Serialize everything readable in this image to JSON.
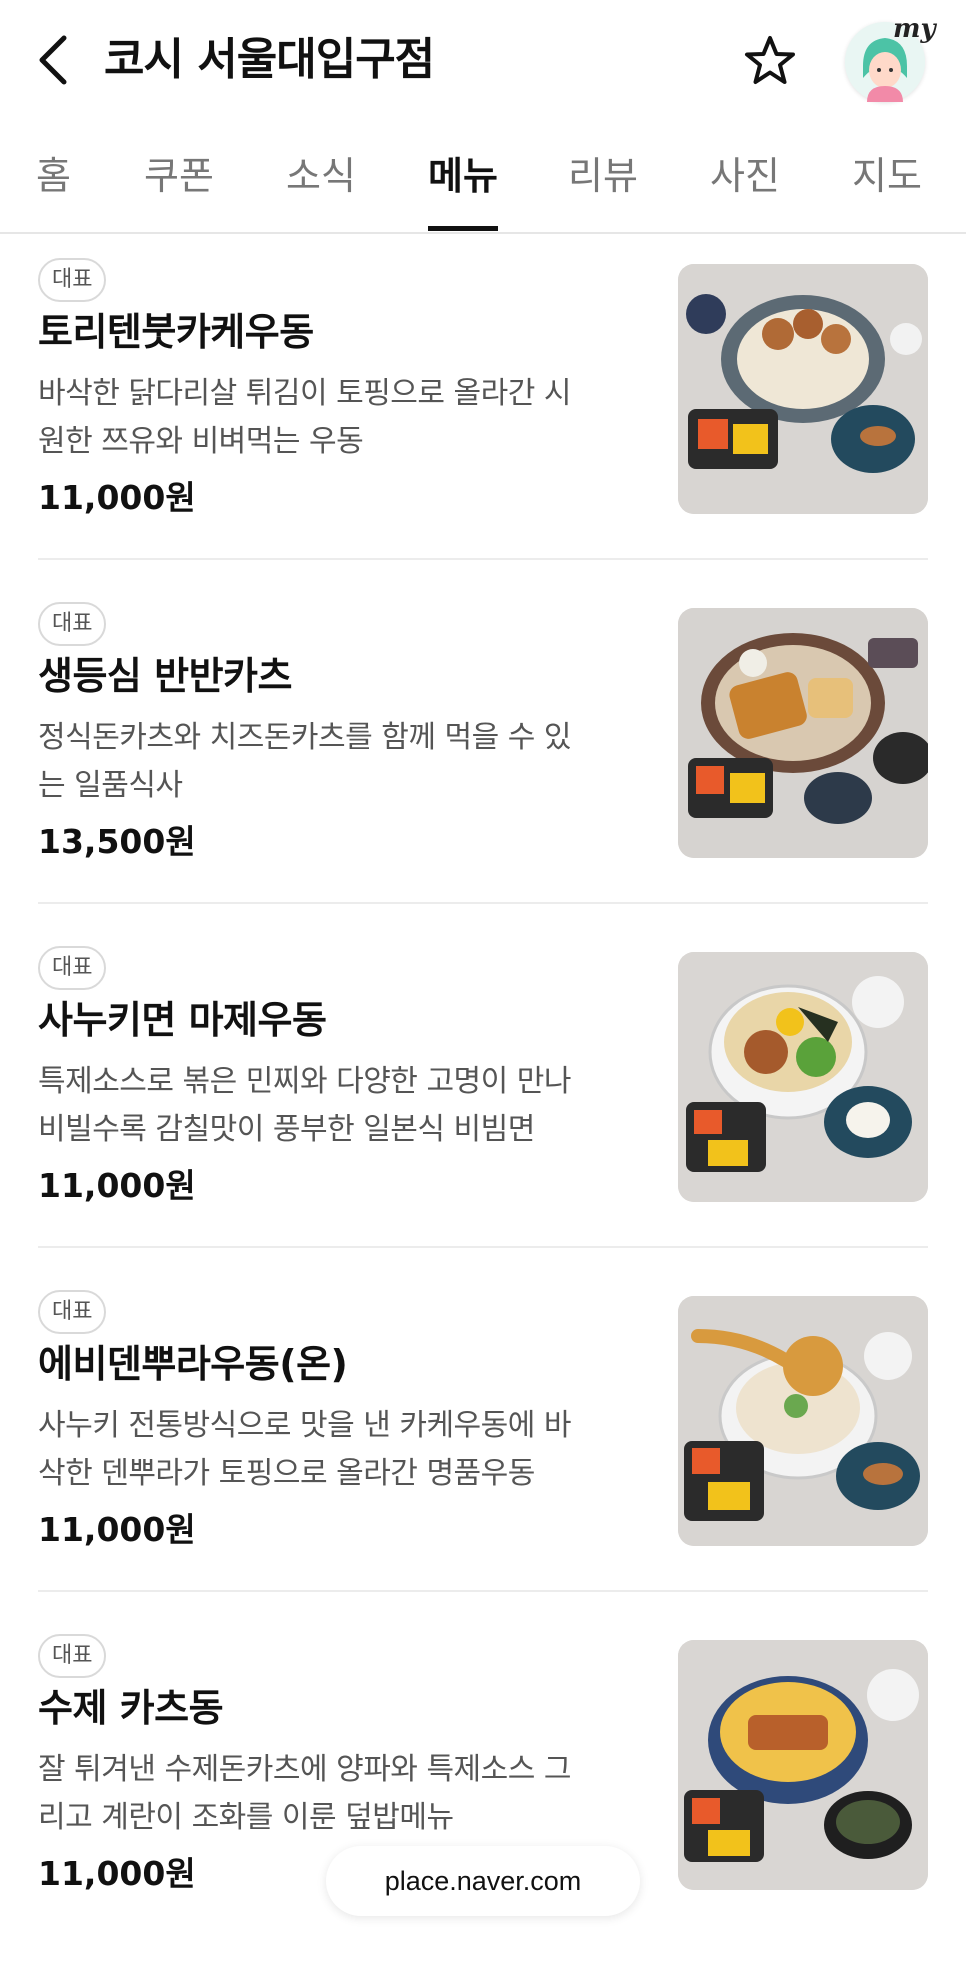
{
  "header": {
    "title": "코시 서울대입구점",
    "back_icon": "chevron-left-icon",
    "favorite_icon": "star-icon",
    "profile_label": "my"
  },
  "tabs": [
    {
      "label": "홈"
    },
    {
      "label": "쿠폰"
    },
    {
      "label": "소식"
    },
    {
      "label": "메뉴",
      "active": true
    },
    {
      "label": "리뷰"
    },
    {
      "label": "사진"
    },
    {
      "label": "지도"
    }
  ],
  "menu": {
    "items": [
      {
        "badge": "대표",
        "name": "토리텐붓카케우동",
        "desc1": "바삭한 닭다리살 튀김이 토핑으로 올라간 시",
        "desc2": "원한 쯔유와 비벼먹는 우동",
        "price": "11,000원"
      },
      {
        "badge": "대표",
        "name": "생등심 반반카츠",
        "desc1": "정식돈카츠와 치즈돈카츠를 함께 먹을 수 있",
        "desc2": "는 일품식사",
        "price": "13,500원"
      },
      {
        "badge": "대표",
        "name": "사누키면 마제우동",
        "desc1": "특제소스로 볶은 민찌와 다양한 고명이 만나",
        "desc2": "비빌수록 감칠맛이 풍부한 일본식 비빔면",
        "price": "11,000원"
      },
      {
        "badge": "대표",
        "name": "에비덴뿌라우동(온)",
        "desc1": "사누키 전통방식으로 맛을 낸 카케우동에 바",
        "desc2": "삭한 덴뿌라가 토핑으로 올라간 명품우동",
        "price": "11,000원"
      },
      {
        "badge": "대표",
        "name": "수제 카츠동",
        "desc1": "잘 튀겨낸 수제돈카츠에 양파와 특제소스 그",
        "desc2": "리고 계란이 조화를 이룬 덮밥메뉴",
        "price": "11,000원"
      }
    ]
  },
  "footer": {
    "url": "place.naver.com"
  },
  "colors": {
    "text": "#111111",
    "muted": "#777777",
    "badge_border": "#d9d9d9",
    "divider": "#ececec"
  }
}
